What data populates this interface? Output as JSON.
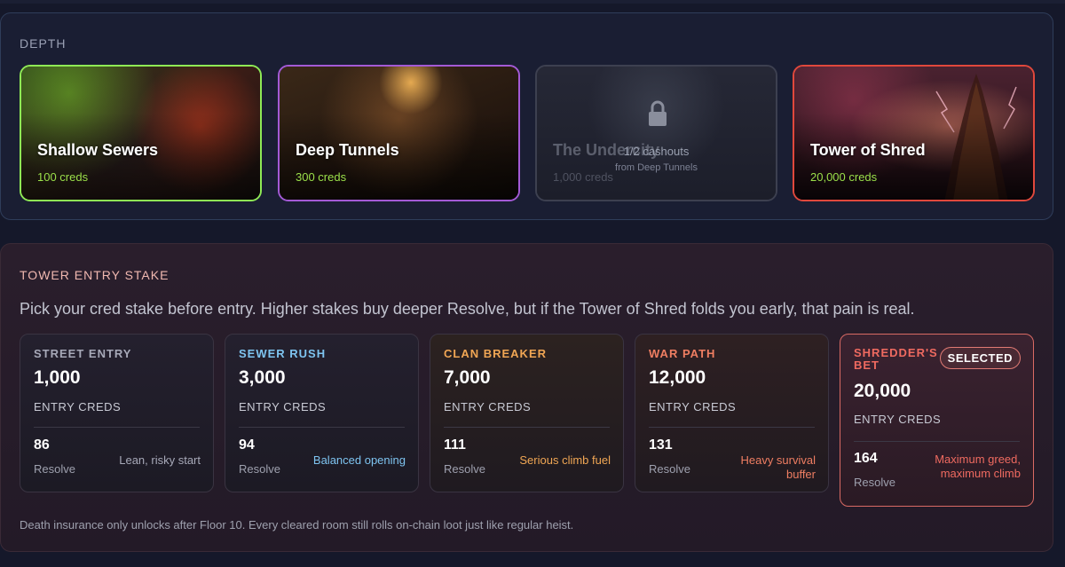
{
  "depth": {
    "label": "DEPTH",
    "cards": [
      {
        "name": "Shallow Sewers",
        "cost": "100 creds",
        "state": "selected",
        "accent": "#8fea55"
      },
      {
        "name": "Deep Tunnels",
        "cost": "300 creds",
        "state": "available",
        "accent": "#a45ad6"
      },
      {
        "name": "The Undercity",
        "cost": "1,000 creds",
        "state": "locked",
        "lock_line1": "1/2 cashouts",
        "lock_line2": "from Deep Tunnels",
        "accent": "#3d4050"
      },
      {
        "name": "Tower of Shred",
        "cost": "20,000 creds",
        "state": "available",
        "accent": "#e0483c"
      }
    ]
  },
  "stake": {
    "label": "TOWER ENTRY STAKE",
    "description": "Pick your cred stake before entry. Higher stakes buy deeper Resolve, but if the Tower of Shred folds you early, that pain is real.",
    "unit_label": "ENTRY CREDS",
    "resolve_label": "Resolve",
    "selected_label": "SELECTED",
    "options": [
      {
        "tier": "STREET ENTRY",
        "amount": "1,000",
        "resolve": "86",
        "tagline": "Lean, risky start",
        "color": "#a7a9b8"
      },
      {
        "tier": "SEWER RUSH",
        "amount": "3,000",
        "resolve": "94",
        "tagline": "Balanced opening",
        "color": "#7ec4f0"
      },
      {
        "tier": "CLAN BREAKER",
        "amount": "7,000",
        "resolve": "111",
        "tagline": "Serious climb fuel",
        "color": "#f0a654"
      },
      {
        "tier": "WAR PATH",
        "amount": "12,000",
        "resolve": "131",
        "tagline": "Heavy survival buffer",
        "color": "#ef7e62"
      },
      {
        "tier": "SHREDDER'S BET",
        "amount": "20,000",
        "resolve": "164",
        "tagline": "Maximum greed, maximum climb",
        "color": "#ef6a60",
        "selected": true
      }
    ],
    "footnote": "Death insurance only unlocks after Floor 10. Every cleared room still rolls on-chain loot just like regular heist."
  }
}
